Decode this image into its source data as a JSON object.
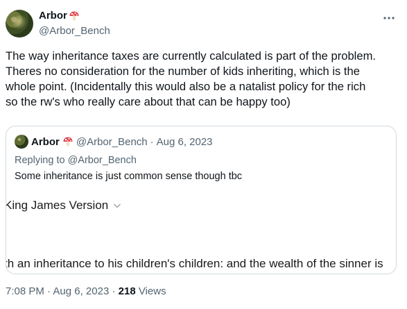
{
  "author": {
    "display_name": "Arbor",
    "handle": "@Arbor_Bench",
    "name_emoji": "mushroom-icon"
  },
  "more_icon": "more-icon",
  "tweet": {
    "lines": [
      "The way inheritance taxes are currently calculated is part of the problem.",
      "Theres no consideration for the number of kids inheriting, which is the",
      "whole point. (Incidentally this would also be a natalist policy for the rich",
      "so the rw's who really care about that can be happy too)"
    ]
  },
  "quote": {
    "display_name": "Arbor",
    "handle": "@Arbor_Bench",
    "separator": "·",
    "date": "Aug 6, 2023",
    "replying_prefix": "Replying to",
    "replying_handle": "@Arbor_Bench",
    "text": "Some inheritance is just common sense though tbc",
    "image": {
      "version_label": "King James Version",
      "verse_text": "th an inheritance to his children's children: and the wealth of the sinner is"
    }
  },
  "footer": {
    "time": "7:08 PM",
    "separator": "·",
    "date": "Aug 6, 2023",
    "views_count": "218",
    "views_label": "Views"
  },
  "colors": {
    "text_primary": "#0f1419",
    "text_secondary": "#536471",
    "border": "#cfd9de"
  }
}
